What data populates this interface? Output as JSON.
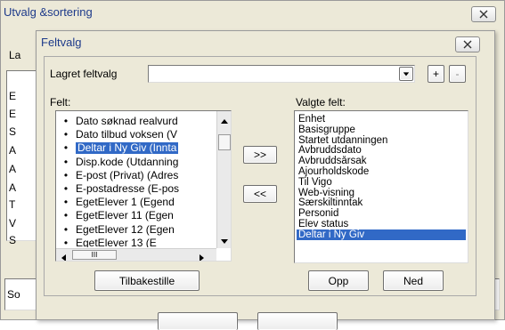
{
  "outer_window": {
    "title": "Utvalg &sortering",
    "edge_fragments": [
      "La",
      "E",
      "E",
      "S",
      "A",
      "A",
      "A",
      "T",
      "V",
      "S"
    ],
    "bottom_fragment": "So"
  },
  "dialog": {
    "title": "Feltvalg",
    "saved_label": "Lagret feltvalg",
    "saved_value": "",
    "add_button": "+",
    "remove_button": "-",
    "available_label": "Felt:",
    "available_items": [
      "Dato søknad realvurd",
      "Dato tilbud voksen (V",
      "Deltar i Ny Giv (Innta",
      "Disp.kode (Utdanning",
      "E-post (Privat) (Adres",
      "E-postadresse (E-pos",
      "EgetElever 1 (Egend",
      "EgetElever 11 (Egen",
      "EgetElever 12 (Egen",
      "EgetElever 13 (E"
    ],
    "available_selected_index": 2,
    "hscroll_grip": "III",
    "move_right_button": ">>",
    "move_left_button": "<<",
    "selected_label": "Valgte felt:",
    "selected_items": [
      "Enhet",
      "Basisgruppe",
      "Startet utdanningen",
      "Avbruddsdato",
      "Avbruddsårsak",
      "Ajourholdskode",
      "Til Vigo",
      "Web-visning",
      "Særskiltinntak",
      "Personid",
      "Elev status",
      "Deltar i Ny Giv"
    ],
    "selected_selected_index": 11,
    "reset_button": "Tilbakestille",
    "up_button": "Opp",
    "down_button": "Ned"
  },
  "colors": {
    "selection": "#3169c6",
    "title_text": "#1d3a8a",
    "face": "#ece9d8"
  }
}
